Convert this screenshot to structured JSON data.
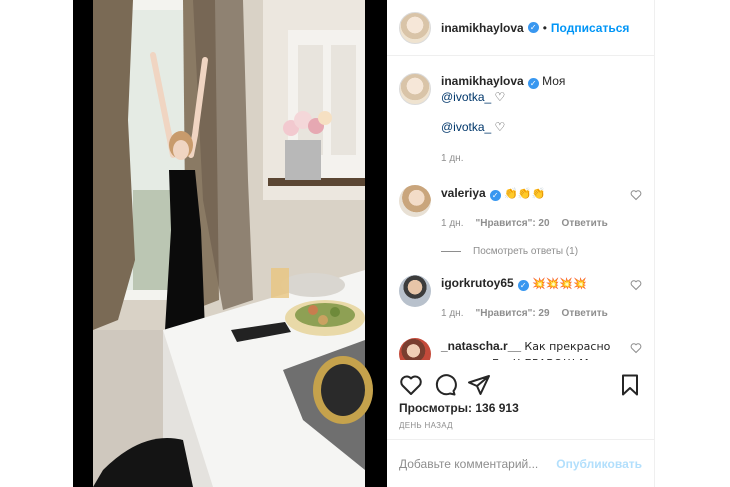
{
  "post": {
    "author": "inamikhaylova",
    "separator": "•",
    "follow_label": "Подписаться",
    "caption": {
      "username": "inamikhaylova",
      "text": "Моя",
      "mention": "@ivotka_",
      "heart": "♡",
      "second_line_mention": "@ivotka_",
      "second_line_heart": "♡",
      "time": "1 дн."
    },
    "comments": [
      {
        "username": "valeriya",
        "text": "👏👏👏",
        "time": "1 дн.",
        "likes": "\"Нравится\": 20",
        "reply": "Ответить",
        "view_replies": "Посмотреть ответы (1)"
      },
      {
        "username": "igorkrutoy65",
        "text": "💥💥💥💥",
        "time": "1 дн.",
        "likes": "\"Нравится\": 29",
        "reply": "Ответить"
      },
      {
        "username": "_natascha.r__",
        "text": "Как прекрасно танцует Ева!! БРАВО!!! Милая нежная Доченька!!! Красивый подарок для мамы 🔥❤️👏👏"
      }
    ],
    "views_label": "Просмотры:",
    "views_count": "136 913",
    "posted_when": "День назад",
    "comment_placeholder": "Добавьте комментарий...",
    "publish_label": "Опубликовать"
  },
  "icons": [
    "heart-icon",
    "comment-icon",
    "share-icon",
    "bookmark-icon",
    "verified-badge-icon"
  ],
  "colors": {
    "accent": "#0095f6",
    "verified": "#3897f0",
    "muted": "#8e8e8e",
    "publish_disabled": "#b2dffc"
  }
}
